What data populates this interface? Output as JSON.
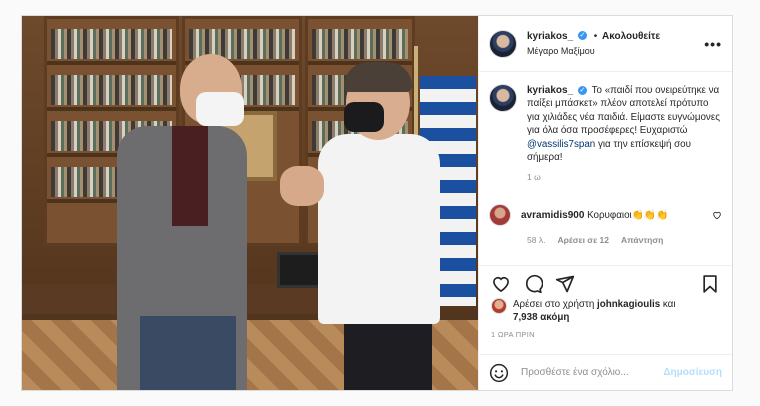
{
  "header": {
    "username": "kyriakos_",
    "verified_mark": "✓",
    "separator": "•",
    "follow_label": "Ακολουθείτε",
    "location": "Μέγαρο Μαξίμου",
    "more_label": "•••"
  },
  "caption": {
    "username": "kyriakos_",
    "text_before": "Το «παιδί που ονειρεύτηκε να παίξει μπάσκετ» πλέον αποτελεί πρότυπο για χιλιάδες νέα παιδιά. Είμαστε ευγνώμονες για όλα όσα προσέφερες! Ευχαριστώ",
    "mention": "@vassilis7span",
    "text_after": "για την επίσκεψή σου σήμερα!",
    "time": "1 ω"
  },
  "comment": {
    "username": "avramidis900",
    "text": "Κορυφαιοι👏👏👏",
    "time": "58 λ.",
    "likes": "Αρέσει σε 12",
    "reply": "Απάντηση"
  },
  "likes": {
    "prefix": "Αρέσει στο χρήστη",
    "user": "johnkagioulis",
    "mid": "και",
    "count": "7,938 ακόμη"
  },
  "timestamp": "1 ΩΡΑ ΠΡΙΝ",
  "add_comment": {
    "placeholder": "Προσθέστε ένα σχόλιο...",
    "post_label": "Δημοσίευση"
  },
  "icons": {
    "like": "heart-icon",
    "comment": "comment-icon",
    "share": "share-icon",
    "save": "bookmark-icon",
    "emoji": "emoji-icon"
  },
  "colors": {
    "verified": "#3897f0",
    "mention": "#00376b",
    "post_button": "#b2dffc"
  }
}
